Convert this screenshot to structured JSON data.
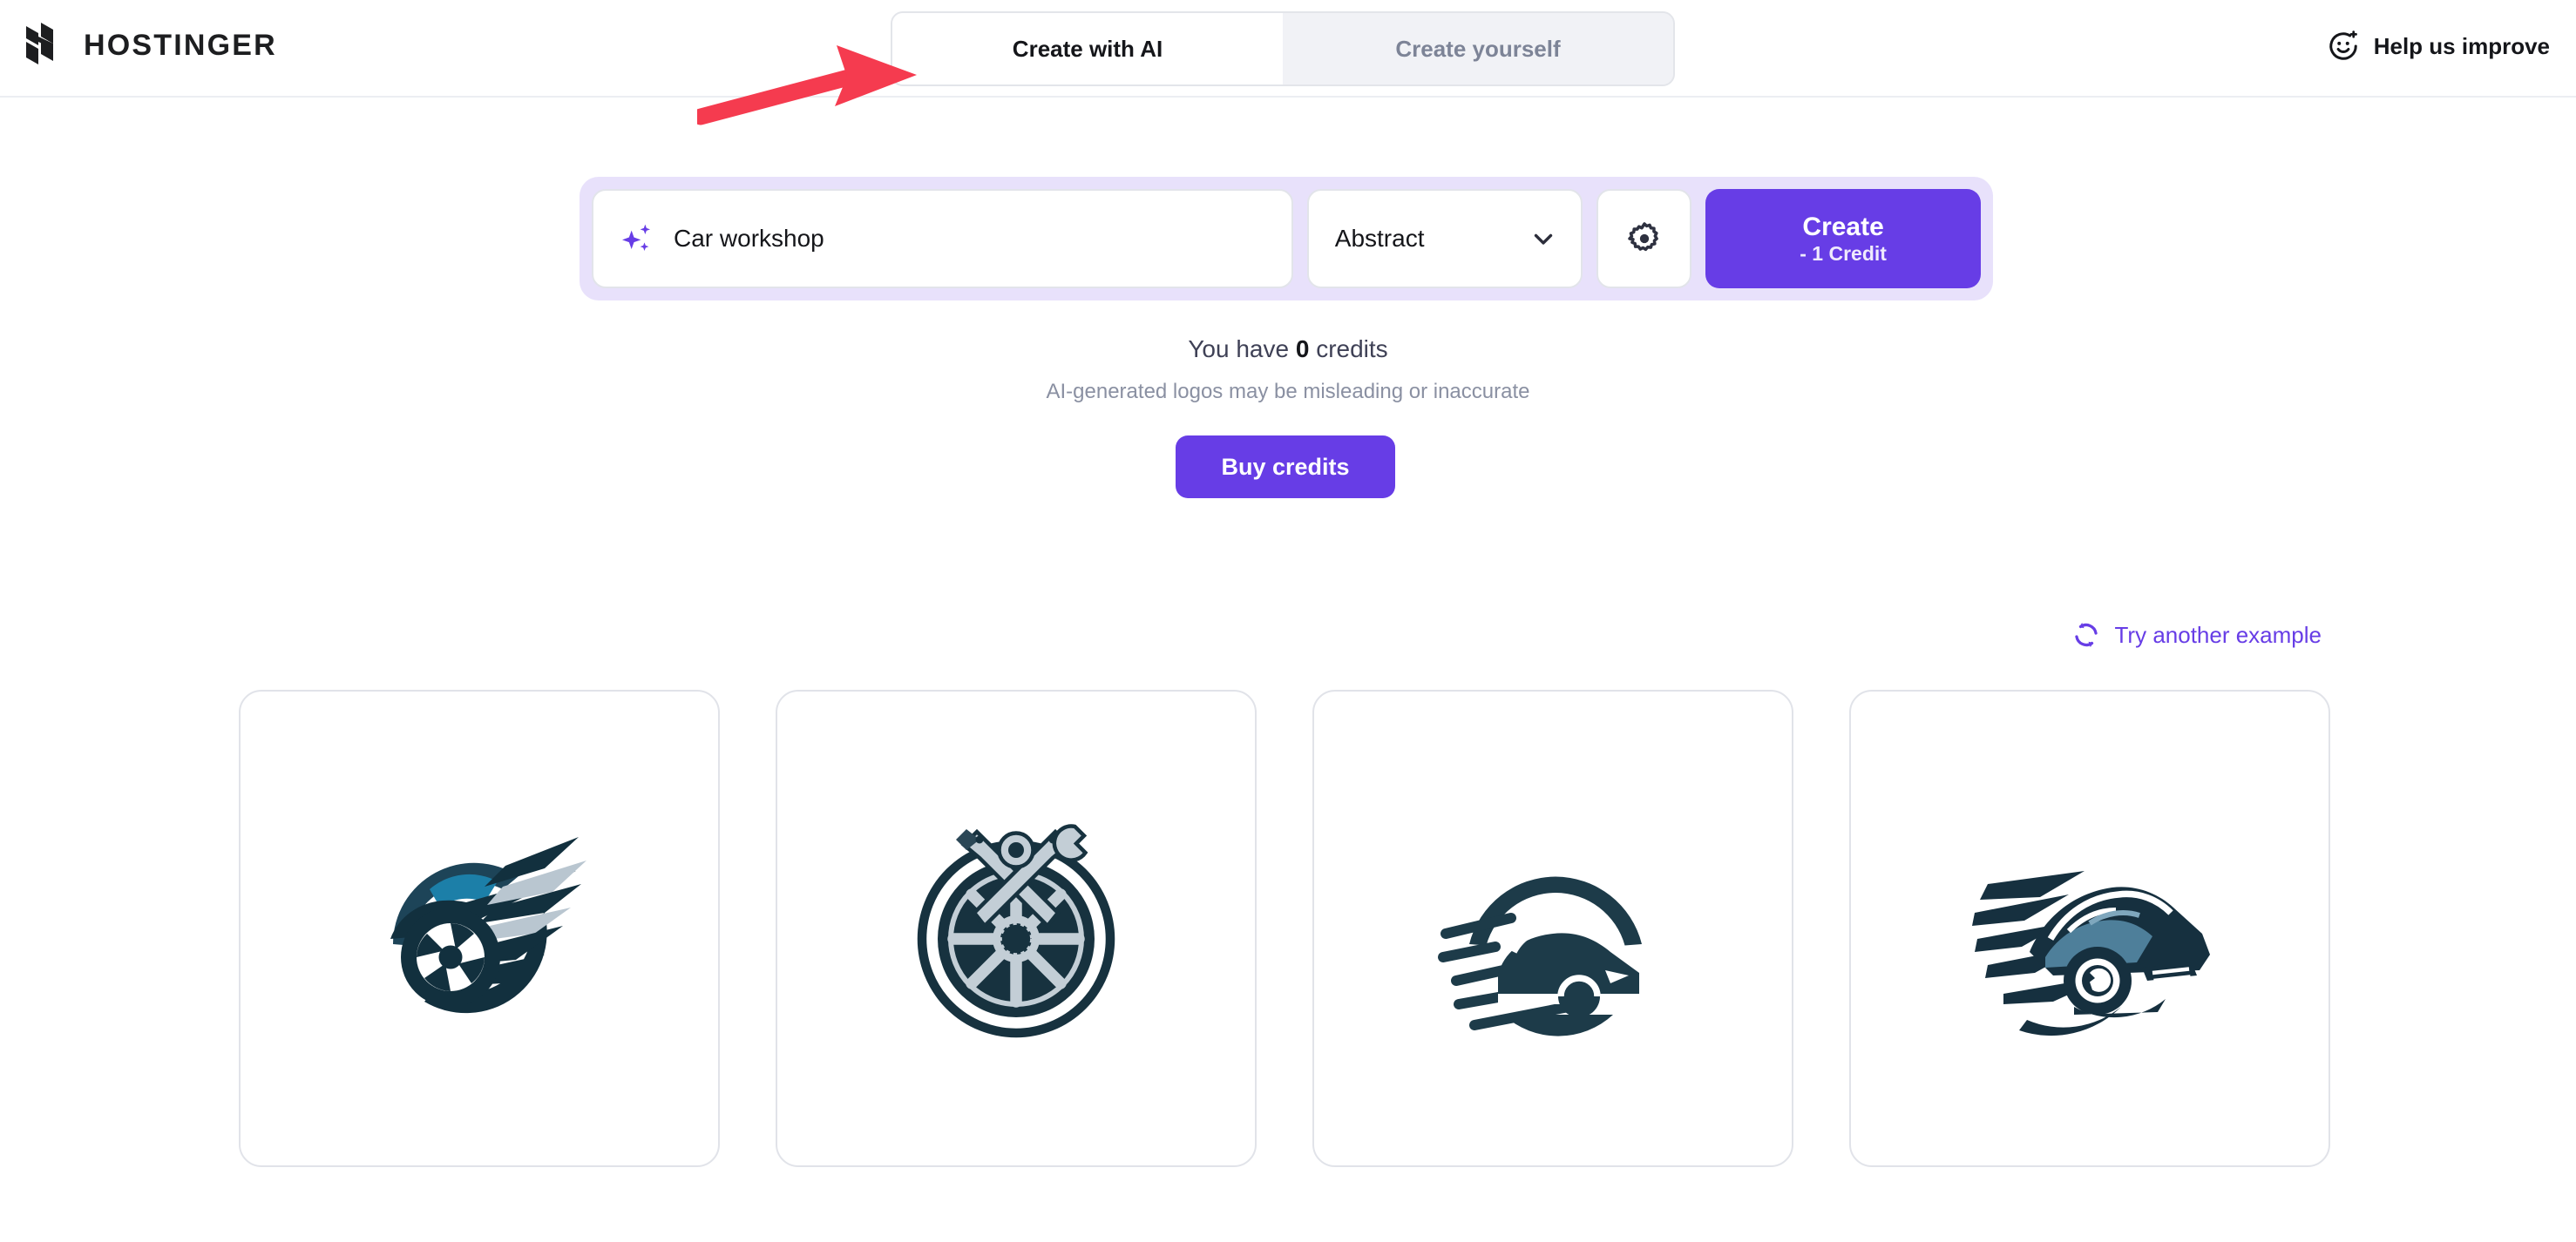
{
  "header": {
    "brand_name": "HOSTINGER",
    "brand_mark_icon": "hostinger-h-logo",
    "tabs": [
      {
        "label": "Create with AI",
        "active": true
      },
      {
        "label": "Create yourself",
        "active": false
      }
    ],
    "help": {
      "label": "Help us improve",
      "icon": "smiley-sparkle-icon"
    },
    "annotation": {
      "type": "red-arrow",
      "color": "#f53b4f",
      "points_to": "Create with AI"
    }
  },
  "generator": {
    "prompt": {
      "icon": "sparkles-icon",
      "value": "Car workshop",
      "placeholder": "Describe your business"
    },
    "style_select": {
      "value": "Abstract",
      "icon": "chevron-down-icon"
    },
    "settings_button": {
      "icon": "gear-icon"
    },
    "create_button": {
      "label": "Create",
      "sublabel": "- 1 Credit"
    },
    "accent_color": "#673de6",
    "wrapper_color": "#e8e1fb"
  },
  "credits": {
    "prefix": "You have ",
    "amount": "0",
    "suffix": " credits",
    "disclaimer": "AI-generated logos may be misleading or inaccurate",
    "buy_button_label": "Buy credits"
  },
  "results": {
    "try_another_label": "Try another example",
    "try_another_icon": "refresh-icon",
    "cards": [
      {
        "name": "logo-abstract-car-wheel-swoosh",
        "palette": [
          "#16303f",
          "#0f2733",
          "#1c7fa8",
          "#b9c6d0"
        ]
      },
      {
        "name": "logo-wheel-wrenches-gear",
        "palette": [
          "#17323f",
          "#2b4756",
          "#c3ced6"
        ]
      },
      {
        "name": "logo-speeding-car-arc",
        "palette": [
          "#1d3b49"
        ]
      },
      {
        "name": "logo-sports-car-speed-lines",
        "palette": [
          "#16303f",
          "#4e7f9a",
          "#7fa7bd"
        ]
      }
    ]
  }
}
